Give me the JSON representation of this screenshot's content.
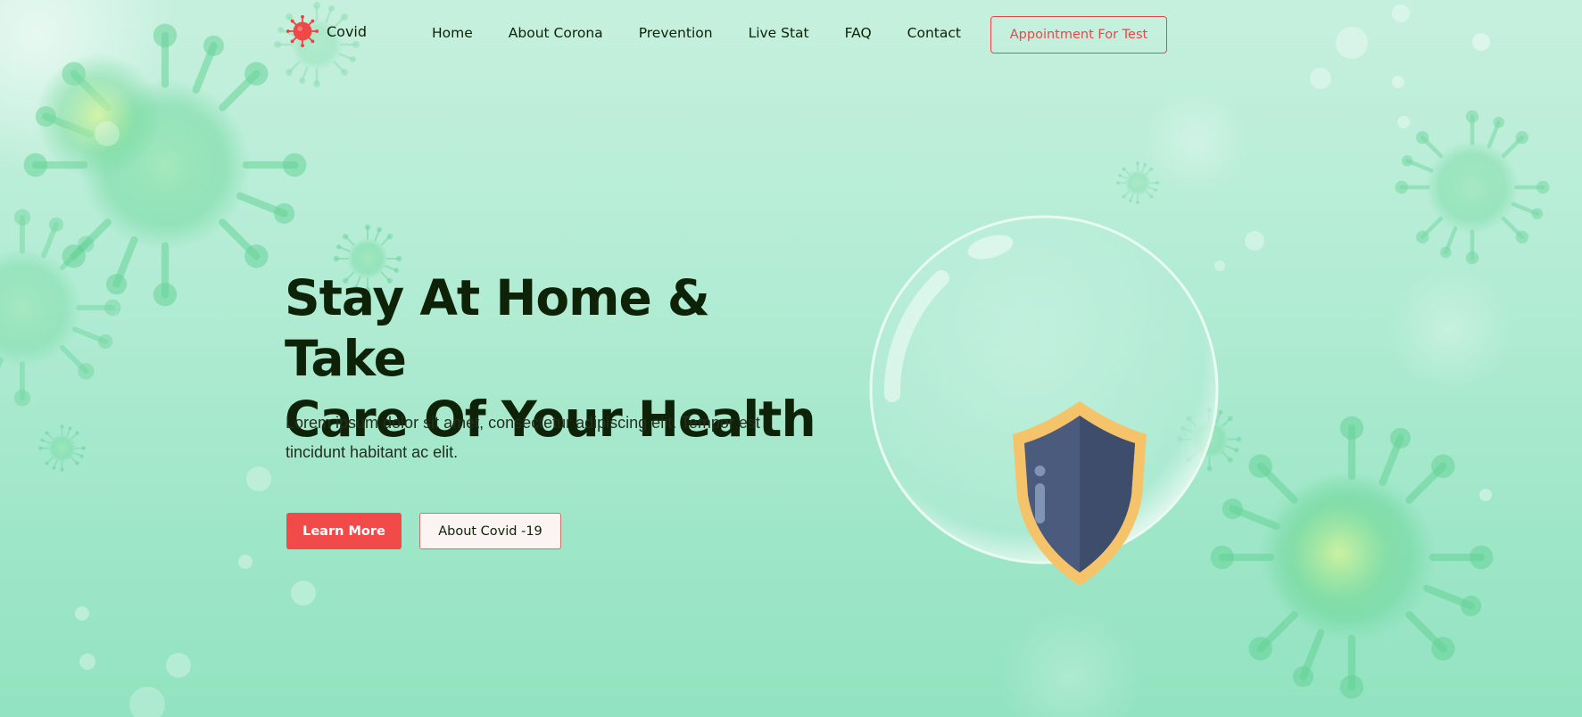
{
  "brand": {
    "name": "Covid",
    "accent": "#f24a48"
  },
  "nav": {
    "items": [
      {
        "label": "Home"
      },
      {
        "label": "About Corona"
      },
      {
        "label": "Prevention"
      },
      {
        "label": "Live Stat"
      },
      {
        "label": "FAQ"
      },
      {
        "label": "Contact"
      }
    ],
    "cta_label": "Appointment For Test"
  },
  "hero": {
    "title_line1": "Stay At Home & Take",
    "title_line2": "Care Of Your Health",
    "description_line1": "Lorem ipsum dolor sit amet, consectetur adipiscing elit. Tempor est",
    "description_line2": "tincidunt habitant ac elit.",
    "primary_button": "Learn More",
    "secondary_button": "About Covid -19"
  },
  "icons": {
    "logo": "virus-icon",
    "illustration": "masked-family-shield-bubble"
  }
}
